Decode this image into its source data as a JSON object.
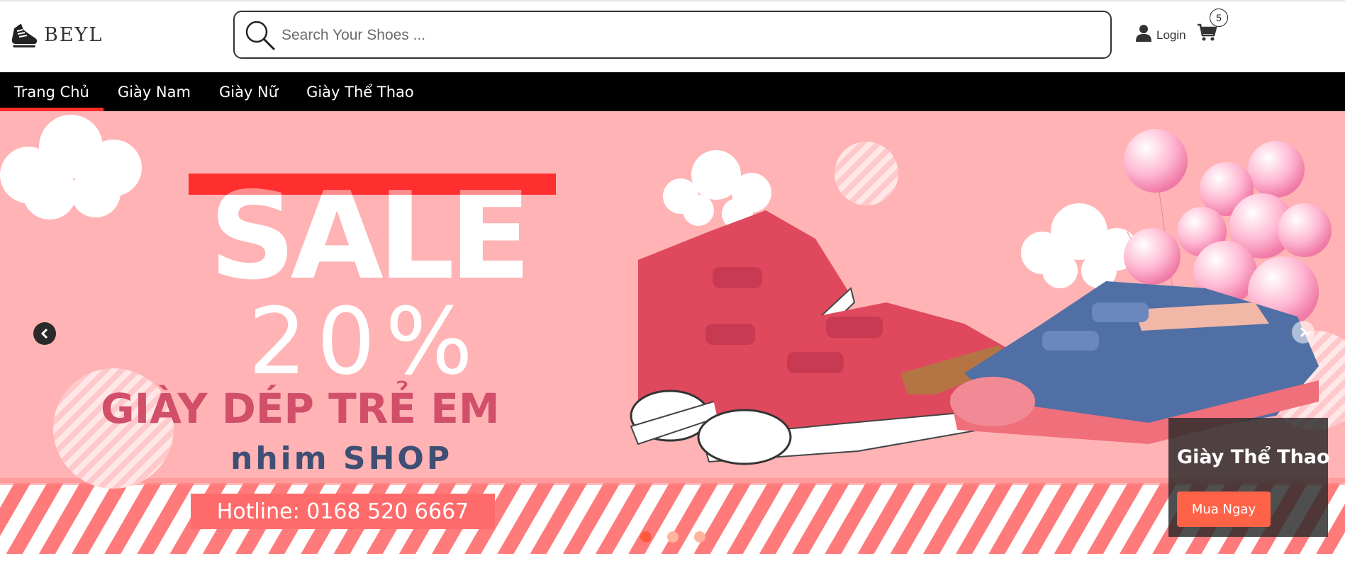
{
  "brand": {
    "name": "BEYL",
    "logo_icon": "shoe-icon"
  },
  "search": {
    "placeholder": "Search Your Shoes ...",
    "value": ""
  },
  "account": {
    "login_label": "Login",
    "cart_count": "5"
  },
  "nav": {
    "items": [
      {
        "label": "Trang Chủ",
        "active": true
      },
      {
        "label": "Giày Nam",
        "active": false
      },
      {
        "label": "Giày Nữ",
        "active": false
      },
      {
        "label": "Giày Thể Thao",
        "active": false
      }
    ]
  },
  "banner": {
    "sale_word": "SALE",
    "discount": "20%",
    "headline": "GIÀY DÉP TRẺ EM",
    "shop_name": "nhim SHOP",
    "hotline": "Hotline: 0168 520 6667",
    "caption_title": "Giày Thể Thao",
    "caption_button": "Mua Ngay",
    "slides_total": 3,
    "slide_active": 1
  },
  "colors": {
    "nav_bg": "#000000",
    "nav_active_underline": "#ff2d2d",
    "banner_bg": "#ffb3b5",
    "cta": "#ff6347"
  }
}
